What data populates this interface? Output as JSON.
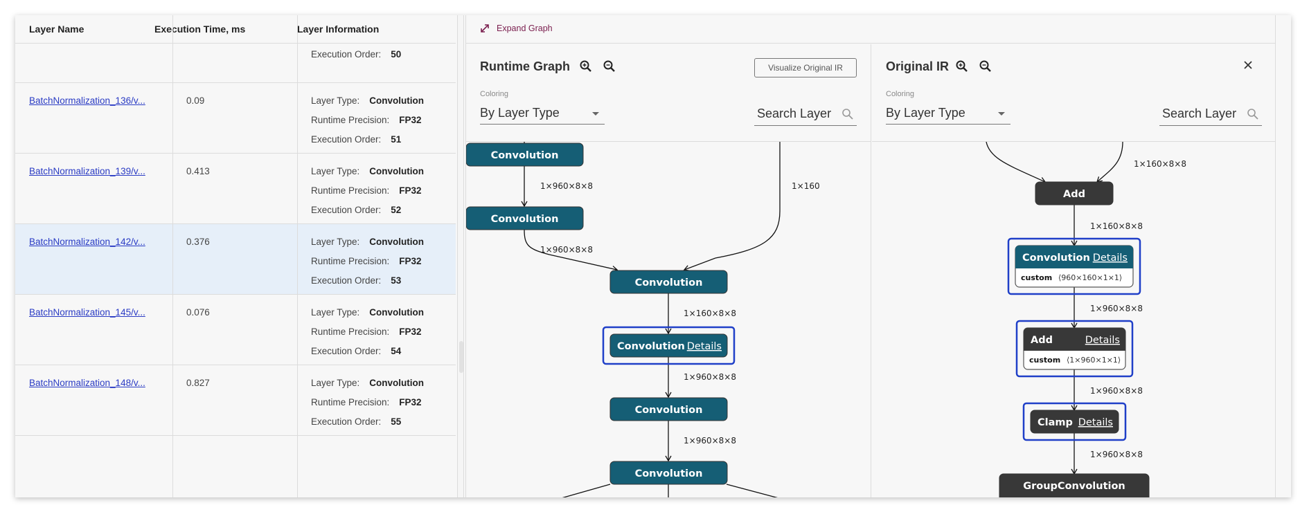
{
  "table": {
    "headers": {
      "name": "Layer Name",
      "time": "Execution Time, ms",
      "info": "Layer Information"
    },
    "info_labels": {
      "type": "Layer Type:",
      "precision": "Runtime Precision:",
      "order": "Execution Order:"
    },
    "partial_row": {
      "order": "50"
    },
    "rows": [
      {
        "name": "BatchNormalization_136/v...",
        "time": "0.09",
        "type": "Convolution",
        "precision": "FP32",
        "order": "51",
        "selected": false
      },
      {
        "name": "BatchNormalization_139/v...",
        "time": "0.413",
        "type": "Convolution",
        "precision": "FP32",
        "order": "52",
        "selected": false
      },
      {
        "name": "BatchNormalization_142/v...",
        "time": "0.376",
        "type": "Convolution",
        "precision": "FP32",
        "order": "53",
        "selected": true
      },
      {
        "name": "BatchNormalization_145/v...",
        "time": "0.076",
        "type": "Convolution",
        "precision": "FP32",
        "order": "54",
        "selected": false
      },
      {
        "name": "BatchNormalization_148/v...",
        "time": "0.827",
        "type": "Convolution",
        "precision": "FP32",
        "order": "55",
        "selected": false
      }
    ]
  },
  "graph_panel": {
    "expand_label": "Expand Graph",
    "runtime": {
      "title": "Runtime Graph",
      "visualize_label": "Visualize Original IR",
      "coloring_label": "Coloring",
      "coloring_value": "By Layer Type",
      "search_placeholder": "Search Layer",
      "nodes": [
        {
          "label": "Convolution"
        },
        {
          "label": "Convolution"
        },
        {
          "label": "Convolution"
        },
        {
          "label": "Convolution",
          "details": "Details",
          "selected": true
        },
        {
          "label": "Convolution"
        },
        {
          "label": "Convolution"
        }
      ],
      "edges": [
        "1×960×8×8",
        "1×960×8×8",
        "1×160",
        "1×160×8×8",
        "1×960×8×8",
        "1×960×8×8"
      ]
    },
    "original": {
      "title": "Original IR",
      "coloring_label": "Coloring",
      "coloring_value": "By Layer Type",
      "search_placeholder": "Search Layer",
      "nodes": [
        {
          "label": "Add"
        },
        {
          "label": "Convolution",
          "details": "Details",
          "sub_key": "custom",
          "sub_val": "⟨960×160×1×1⟩",
          "selected": true
        },
        {
          "label": "Add",
          "details": "Details",
          "sub_key": "custom",
          "sub_val": "⟨1×960×1×1⟩",
          "selected": true
        },
        {
          "label": "Clamp",
          "details": "Details",
          "selected": true
        },
        {
          "label": "GroupConvolution"
        }
      ],
      "edges": [
        "1×160×8×8",
        "1×160×8×8",
        "1×960×8×8",
        "1×960×8×8",
        "1×960×8×8"
      ]
    }
  },
  "colors": {
    "conv": "#155e75",
    "dark": "#383838",
    "highlight": "#1f3fc8",
    "link": "#2a3bc4",
    "expand": "#7a1e4e"
  }
}
